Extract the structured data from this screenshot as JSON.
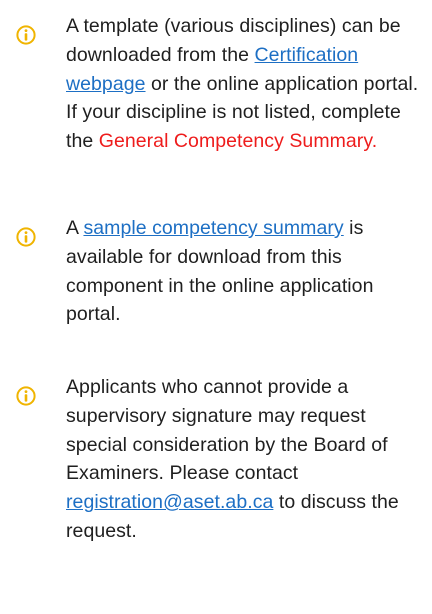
{
  "colors": {
    "icon": "#f0b400",
    "link": "#1d6fc4",
    "emphasis": "#ee1c1c",
    "text": "#1f1f1f"
  },
  "notes": [
    {
      "icon": "info-icon",
      "text_before": "A template (various disciplines) can be downloaded from the ",
      "link_text": "Certification webpage",
      "text_middle": " or the online application portal. If your discipline is not listed, complete the ",
      "emphasis_text": "General Competency Summary."
    },
    {
      "icon": "info-icon",
      "text_before": "A ",
      "link_text": "sample competency summary",
      "text_after": " is available for download from this component in the online application portal."
    },
    {
      "icon": "info-icon",
      "text_before": "Applicants who cannot provide a supervisory signature may request special consideration by the Board of Examiners. Please contact ",
      "link_text": "registration@aset.ab.ca",
      "text_after": " to discuss the request."
    }
  ]
}
